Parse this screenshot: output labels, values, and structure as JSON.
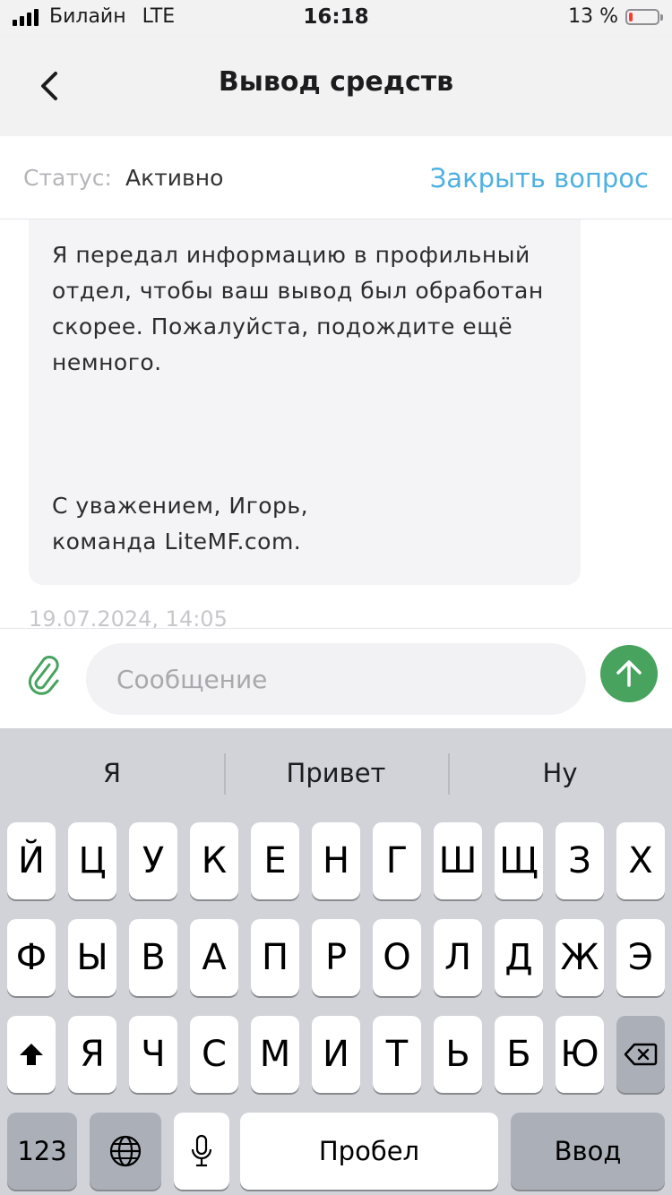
{
  "status_bar": {
    "carrier": "Билайн",
    "network": "LTE",
    "time": "16:18",
    "battery_text": "13 %",
    "battery_level": 0.13,
    "battery_color": "#ff3b30"
  },
  "nav": {
    "back_icon": "chevron-left-icon",
    "title": "Вывод средств"
  },
  "ticket": {
    "status_label": "Статус:",
    "status_value": "Активно",
    "close_label": "Закрыть вопрос",
    "accent_color": "#4fb0e0"
  },
  "message": {
    "lines": [
      "Я передал информацию в профильный",
      "отдел, чтобы ваш вывод был обработан",
      "скорее. Пожалуйста, подождите ещё",
      "немного."
    ],
    "signature": [
      "С уважением, Игорь,",
      "команда LiteMF.com."
    ],
    "timestamp": "19.07.2024, 14:05"
  },
  "composer": {
    "attach_icon": "paperclip-icon",
    "placeholder": "Сообщение",
    "send_icon": "arrow-up-icon",
    "send_color": "#47a35e"
  },
  "keyboard": {
    "suggestions": [
      "Я",
      "Привет",
      "Ну"
    ],
    "row1": [
      "Й",
      "Ц",
      "У",
      "К",
      "Е",
      "Н",
      "Г",
      "Ш",
      "Щ",
      "З",
      "Х"
    ],
    "row2": [
      "Ф",
      "Ы",
      "В",
      "А",
      "П",
      "Р",
      "О",
      "Л",
      "Д",
      "Ж",
      "Э"
    ],
    "row3": [
      "Я",
      "Ч",
      "С",
      "М",
      "И",
      "Т",
      "Ь",
      "Б",
      "Ю"
    ],
    "shift_icon": "shift-icon",
    "delete_icon": "backspace-icon",
    "numbers_label": "123",
    "globe_icon": "globe-icon",
    "mic_icon": "microphone-icon",
    "space_label": "Пробел",
    "return_label": "Ввод"
  }
}
